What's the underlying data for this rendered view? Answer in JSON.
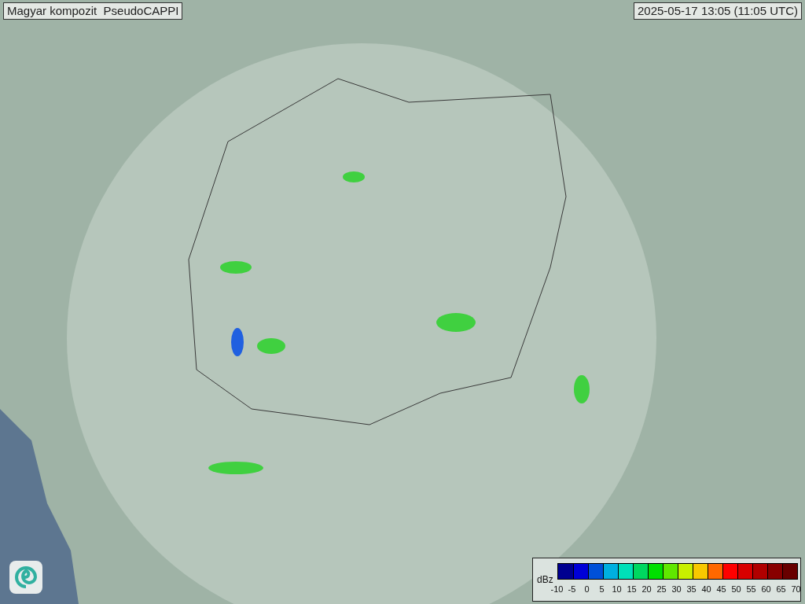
{
  "title": "Magyar kompozit  PseudoCAPPI",
  "timestamp": "2025-05-17 13:05 (11:05 UTC)",
  "legend": {
    "unit": "dBz",
    "swatches": [
      {
        "color": "#000090"
      },
      {
        "color": "#0000d8"
      },
      {
        "color": "#0050d8"
      },
      {
        "color": "#00b0e0"
      },
      {
        "color": "#00e0b8"
      },
      {
        "color": "#00d860"
      },
      {
        "color": "#00e000"
      },
      {
        "color": "#60e800"
      },
      {
        "color": "#c8f000"
      },
      {
        "color": "#f8c800"
      },
      {
        "color": "#ff6800"
      },
      {
        "color": "#ff0000"
      },
      {
        "color": "#d80000"
      },
      {
        "color": "#b00000"
      },
      {
        "color": "#880000"
      },
      {
        "color": "#680000"
      }
    ],
    "ticks": [
      "-10",
      "-5",
      "0",
      "5",
      "10",
      "15",
      "20",
      "25",
      "30",
      "35",
      "40",
      "45",
      "50",
      "55",
      "60",
      "65",
      "70"
    ]
  }
}
